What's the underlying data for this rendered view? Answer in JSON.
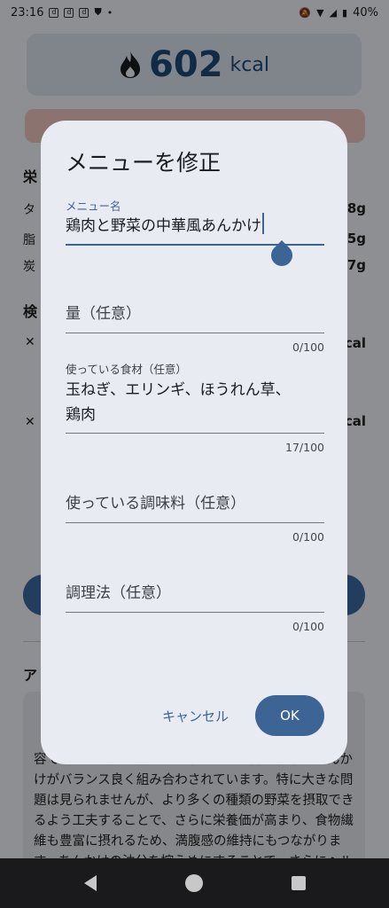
{
  "status": {
    "time": "23:16",
    "battery": "40%"
  },
  "background": {
    "kcal_value": "602",
    "kcal_unit": "kcal",
    "section_nutrition": "栄",
    "row1_label": "タ",
    "row1_value": "8g",
    "row2_label": "脂",
    "row2_value": "5g",
    "row3_label": "炭",
    "row3_value": "7g",
    "section_search": "検",
    "item1_value": "cal",
    "item2_value": "cal",
    "section_advice": "ア",
    "advice_text": "容です。主食のご飯と、主菜となる鶏肉と野菜のあんかけがバランス良く組み合わされています。特に大きな問題は見られませんが、より多くの種類の野菜を摂取できるよう工夫することで、さらに栄養価が高まり、食物繊維も豊富に摂れるため、満腹感の維持にもつながります。あんかけの油分を控えめにすることで、さらにヘルシ"
  },
  "dialog": {
    "title": "メニューを修正",
    "menu_name_label": "メニュー名",
    "menu_name_value": "鶏肉と野菜の中華風あんかけ",
    "amount_placeholder": "量（任意）",
    "amount_counter": "0/100",
    "ingredients_label": "使っている食材（任意）",
    "ingredients_value_line1": "玉ねぎ、エリンギ、ほうれん草、",
    "ingredients_value_line2": "鶏肉",
    "ingredients_counter": "17/100",
    "seasoning_placeholder": "使っている調味料（任意）",
    "seasoning_counter": "0/100",
    "method_placeholder": "調理法（任意）",
    "method_counter": "0/100",
    "cancel_label": "キャンセル",
    "ok_label": "OK"
  },
  "colors": {
    "primary": "#3c6596",
    "dialog_bg": "#e8ebf2",
    "scrim": "rgba(0,0,0,0.42)"
  }
}
